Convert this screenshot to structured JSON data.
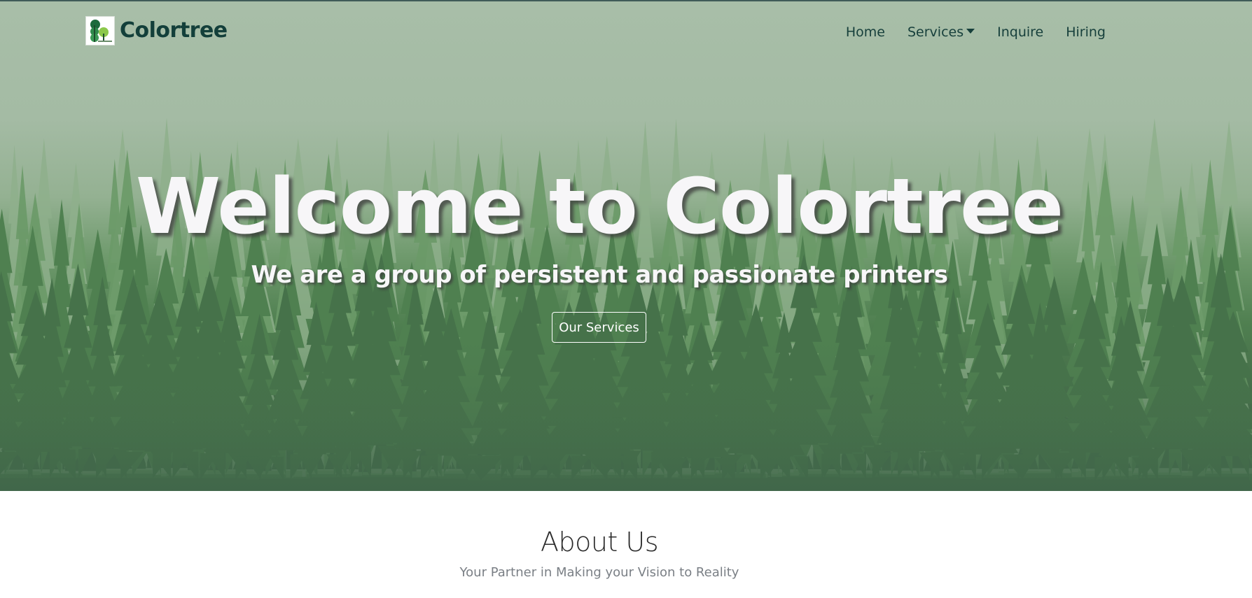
{
  "colors": {
    "brand_text": "#133f3a",
    "nav_text": "#163f3b",
    "hero_text": "#f7f6f8",
    "sky": "#a8bea8",
    "forest_dark": "#41664a",
    "about_subtitle": "#7a7f85"
  },
  "navbar": {
    "brand_name": "Colortree",
    "logo_icon": "colortree-logo",
    "links": [
      {
        "label": "Home"
      },
      {
        "label": "Services",
        "icon": "caret-down-icon"
      },
      {
        "label": "Inquire"
      },
      {
        "label": "Hiring"
      }
    ]
  },
  "hero": {
    "title": "Welcome to Colortree",
    "subtitle": "We are a group of persistent and passionate printers",
    "button_label": "Our Services"
  },
  "about": {
    "title": "About Us",
    "subtitle": "Your Partner in Making your Vision to Reality"
  }
}
